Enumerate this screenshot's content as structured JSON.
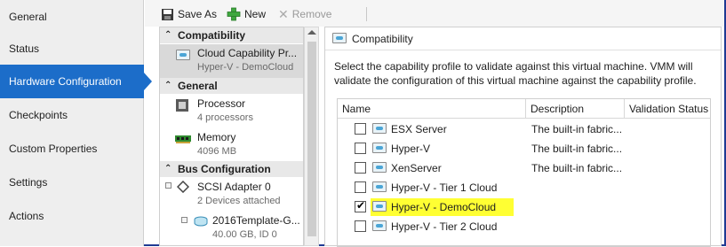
{
  "nav": {
    "items": [
      {
        "label": "General"
      },
      {
        "label": "Status"
      },
      {
        "label": "Hardware Configuration",
        "active": true
      },
      {
        "label": "Checkpoints"
      },
      {
        "label": "Custom Properties"
      },
      {
        "label": "Settings"
      },
      {
        "label": "Actions"
      }
    ]
  },
  "toolbar": {
    "save_as_label": "Save As",
    "new_label": "New",
    "remove_label": "Remove"
  },
  "tree": {
    "compatibility_header": "Compatibility",
    "cloud_capability_title": "Cloud Capability Pr...",
    "cloud_capability_sub": "Hyper-V - DemoCloud",
    "general_header": "General",
    "processor_title": "Processor",
    "processor_sub": "4 processors",
    "memory_title": "Memory",
    "memory_sub": "4096 MB",
    "bus_header": "Bus Configuration",
    "scsi_title": "SCSI Adapter 0",
    "scsi_sub": "2 Devices attached",
    "disk_title": "2016Template-G...",
    "disk_sub": "40.00 GB, ID 0"
  },
  "panel": {
    "title": "Compatibility",
    "description": "Select the capability profile to validate against this virtual machine. VMM will validate the configuration of this virtual machine against the capability profile.",
    "columns": {
      "name": "Name",
      "description": "Description",
      "validation": "Validation Status"
    },
    "rows": [
      {
        "name": "ESX Server",
        "description": "The built-in fabric...",
        "checked": false,
        "selected": false
      },
      {
        "name": "Hyper-V",
        "description": "The built-in fabric...",
        "checked": false,
        "selected": false
      },
      {
        "name": "XenServer",
        "description": "The built-in fabric...",
        "checked": false,
        "selected": false
      },
      {
        "name": "Hyper-V - Tier 1 Cloud",
        "description": "",
        "checked": false,
        "selected": false
      },
      {
        "name": "Hyper-V - DemoCloud",
        "description": "",
        "checked": true,
        "selected": true
      },
      {
        "name": "Hyper-V - Tier 2 Cloud",
        "description": "",
        "checked": false,
        "selected": false
      }
    ]
  },
  "colors": {
    "accent": "#1c6dc9",
    "highlight": "#ffff33"
  }
}
